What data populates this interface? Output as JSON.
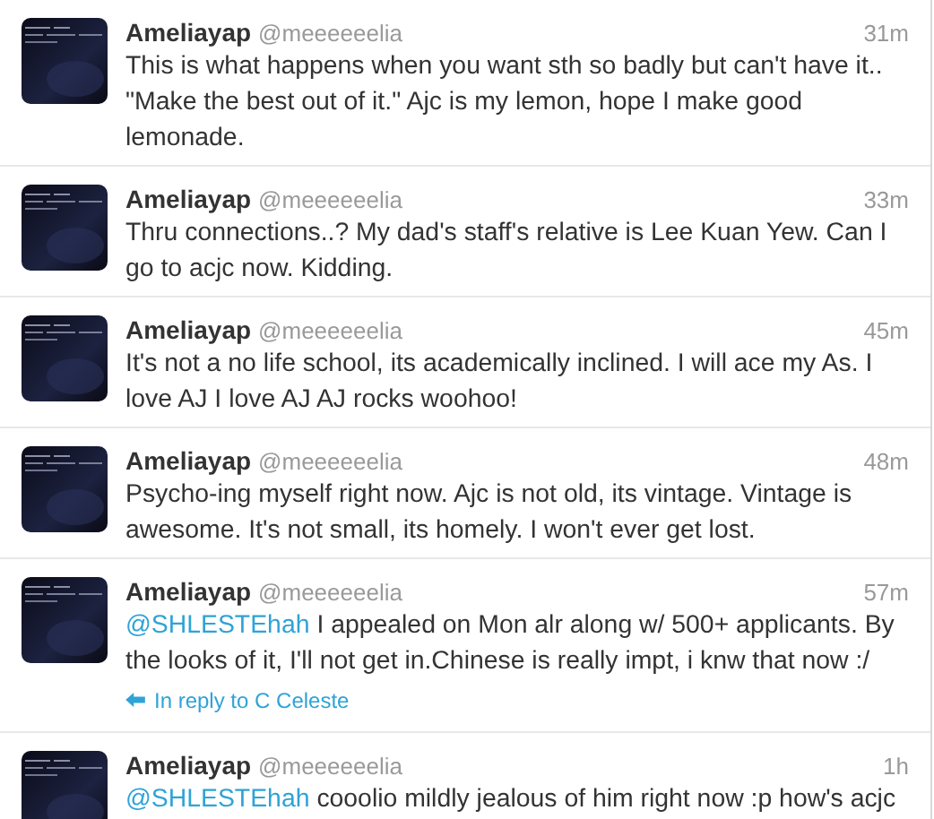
{
  "tweets": [
    {
      "name": "Ameliayap",
      "handle": "@meeeeeelia",
      "time": "31m",
      "text": "This is what happens when you want sth so badly but can't have it.. \"Make the best out of it.\" Ajc is my lemon, hope I make good lemonade."
    },
    {
      "name": "Ameliayap",
      "handle": "@meeeeeelia",
      "time": "33m",
      "text": "Thru connections..? My dad's staff's relative is Lee Kuan Yew. Can I go to acjc now. Kidding."
    },
    {
      "name": "Ameliayap",
      "handle": "@meeeeeelia",
      "time": "45m",
      "text": "It's not a no life school, its academically inclined. I will ace my As. I love AJ I love AJ AJ rocks woohoo!"
    },
    {
      "name": "Ameliayap",
      "handle": "@meeeeeelia",
      "time": "48m",
      "text": "Psycho-ing myself right now. Ajc is not old, its vintage. Vintage is awesome. It's not small, its homely. I won't ever get lost."
    },
    {
      "name": "Ameliayap",
      "handle": "@meeeeeelia",
      "time": "57m",
      "mention": "@SHLESTEhah",
      "text": "I appealed on Mon alr along w/ 500+ applicants. By the looks of it, I'll not get in.Chinese is really impt, i knw that now :/",
      "reply": "In reply to C Celeste"
    },
    {
      "name": "Ameliayap",
      "handle": "@meeeeeelia",
      "time": "1h",
      "mention": "@SHLESTEhah",
      "text": "cooolio mildly jealous of him right now :p how's acjc"
    }
  ]
}
